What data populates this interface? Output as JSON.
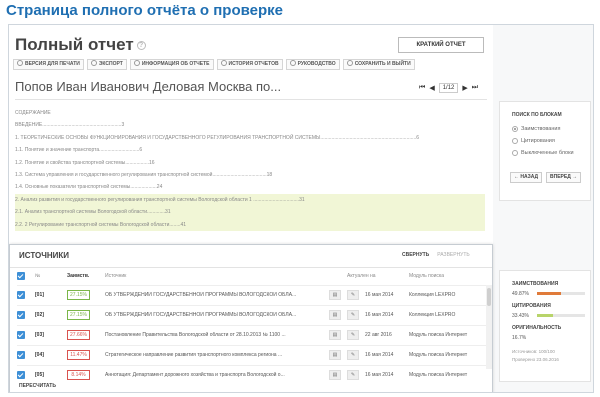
{
  "caption": "Страница полного отчёта о проверке",
  "header": {
    "title": "Полный отчет",
    "short_report_button": "КРАТКИЙ ОТЧЕТ"
  },
  "toolbar": [
    {
      "label": "ВЕРСИЯ ДЛЯ ПЕЧАТИ",
      "icon": "print-icon"
    },
    {
      "label": "ЭКСПОРТ",
      "icon": "export-icon"
    },
    {
      "label": "ИНФОРМАЦИЯ ОБ ОТЧЕТЕ",
      "icon": "info-icon"
    },
    {
      "label": "ИСТОРИЯ ОТЧЕТОВ",
      "icon": "history-icon"
    },
    {
      "label": "РУКОВОДСТВО",
      "icon": "guide-icon"
    },
    {
      "label": "СОХРАНИТЬ И ВЫЙТИ",
      "icon": "save-icon"
    }
  ],
  "document": {
    "title": "Попов Иван Иванович Деловая Москва по...",
    "pager": "1/12"
  },
  "toc": [
    "СОДЕРЖАНИЕ",
    "ВВЕДЕНИЕ.........................................................3",
    "1. ТЕОРЕТИЧЕСКИЕ ОСНОВЫ ФУНКЦИОНИРОВАНИЯ И ГОСУДАРСТВЕННОГО РЕГУЛИРОВАНИЯ ТРАНСПОРТНОЙ СИСТЕМЫ.....................................................................6",
    "1.1. Понятие и значение транспорта.............................6",
    "1.2. Понятие и свойства транспортной системы.................16",
    "1.3. Система управления и государственного регулирования транспортной системой.......................................18",
    "1.4. Основные показатели транспортной системы...................24",
    "2. Анализ развития и государственного регулирования транспортной системы Вологодской области 1 .................................31",
    "2.1. Анализ транспортной системы Вологодской области.............31",
    "2.2. 2 Регулирование транспортной системы Вологодской области........41"
  ],
  "sources": {
    "title": "ИСТОЧНИКИ",
    "collapse_label": "СВЕРНУТЬ",
    "expand_label": "РАЗВЕРНУТЬ",
    "columns": [
      "№",
      "Заимств.",
      "Источник",
      "Актуален на",
      "Модуль поиска"
    ],
    "rows": [
      {
        "idx": "[01]",
        "pct": "27.15%",
        "color": "#7ab648",
        "text": "ОБ УТВЕРЖДЕНИИ ГОСУДАРСТВЕННОЙ ПРОГРАММЫ ВОЛОГОДСКОЙ ОБЛА...",
        "date": "16 мая 2014",
        "module": "Коллекция LEXPRO"
      },
      {
        "idx": "[02]",
        "pct": "27.15%",
        "color": "#7ab648",
        "text": "ОБ УТВЕРЖДЕНИИ ГОСУДАРСТВЕННОЙ ПРОГРАММЫ ВОЛОГОДСКОЙ ОБЛА...",
        "date": "16 мая 2014",
        "module": "Коллекция LEXPRO"
      },
      {
        "idx": "[03]",
        "pct": "27.66%",
        "color": "#d9534f",
        "text": "Постановление Правительства Вологодской области от 28.10.2013 № 1100 ...",
        "date": "22 авг 2016",
        "module": "Модуль поиска Интернет"
      },
      {
        "idx": "[04]",
        "pct": "11.47%",
        "color": "#d9534f",
        "text": "Стратегическое направление развития транспортного комплекса региона ...",
        "date": "16 мая 2014",
        "module": "Модуль поиска Интернет"
      },
      {
        "idx": "[05]",
        "pct": "8.14%",
        "color": "#d9534f",
        "text": "Аннотация: Департамент дорожного хозяйства и транспорта Вологодской о...",
        "date": "16 мая 2014",
        "module": "Модуль поиска Интернет"
      }
    ],
    "recalc_label": "ПЕРЕСЧИТАТЬ"
  },
  "search_panel": {
    "title": "ПОИСК ПО БЛОКАМ",
    "options": [
      "Заимствования",
      "Цитирования",
      "Выключенные блоки"
    ],
    "back_label": "НАЗАД",
    "forward_label": "ВПЕРЕД"
  },
  "stats": [
    {
      "label": "ЗАИМСТВОВАНИЯ",
      "value": "49.87%",
      "fraction": 0.4987,
      "color": "#e07b3a"
    },
    {
      "label": "ЦИТИРОВАНИЯ",
      "value": "33.43%",
      "fraction": 0.3343,
      "color": "#b8d46a"
    },
    {
      "label": "ОРИГИНАЛЬНОСТЬ",
      "value": "16.7%",
      "fraction": 0.167,
      "color": "#cccccc"
    }
  ],
  "meta": {
    "sources_line": "Источников: 100/100",
    "checked_line": "Проверено 23.06.2016"
  }
}
